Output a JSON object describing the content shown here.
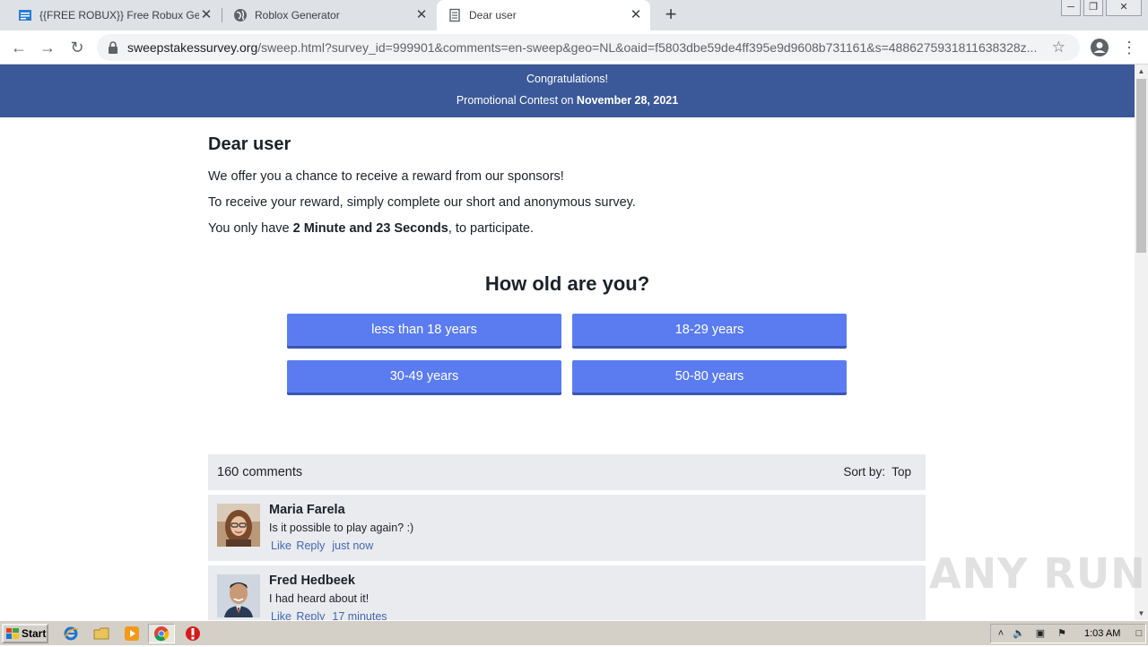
{
  "browser": {
    "tabs": [
      {
        "title": "{{FREE ROBUX}} Free Robux Generat",
        "favicon": "blue-page-icon",
        "active": false
      },
      {
        "title": "Roblox Generator",
        "favicon": "globe-icon",
        "active": false
      },
      {
        "title": "Dear user",
        "favicon": "document-icon",
        "active": true
      }
    ],
    "new_tab_label": "+",
    "close_label": "✕",
    "address": {
      "host": "sweepstakessurvey.org",
      "path": "/sweep.html?survey_id=999901&comments=en-sweep&geo=NL&oaid=f5803dbe59de4ff395e9d9608b731161&s=4886275931811638328z..."
    }
  },
  "banner": {
    "line1": "Congratulations!",
    "line2_prefix": "Promotional Contest on ",
    "line2_date": "November 28, 2021"
  },
  "page": {
    "greeting": "Dear user",
    "para1": "We offer you a chance to receive a reward from our sponsors!",
    "para2": "To receive your reward, simply complete our short and anonymous survey.",
    "para3_prefix": "You only have ",
    "para3_bold": "2 Minute and 23 Seconds",
    "para3_suffix": ", to participate."
  },
  "survey": {
    "question": "How old are you?",
    "answers": [
      "less than 18 years",
      "18-29 years",
      "30-49 years",
      "50-80 years"
    ]
  },
  "comments": {
    "count": "160 comments",
    "sort_label": "Sort by:",
    "sort_value": "Top",
    "items": [
      {
        "name": "Maria Farela",
        "text": "Is it possible to play again? :)",
        "like": "Like",
        "reply": "Reply",
        "time": "just now"
      },
      {
        "name": "Fred Hedbeek",
        "text": "I had heard about it!",
        "like": "Like",
        "reply": "Reply",
        "time": "17 minutes"
      }
    ]
  },
  "watermark": "ANY RUN",
  "taskbar": {
    "start_label": "Start",
    "clock": "1:03 AM"
  },
  "colors": {
    "banner": "#3b5998",
    "button": "#5b7cf0",
    "link": "#4267b2"
  }
}
